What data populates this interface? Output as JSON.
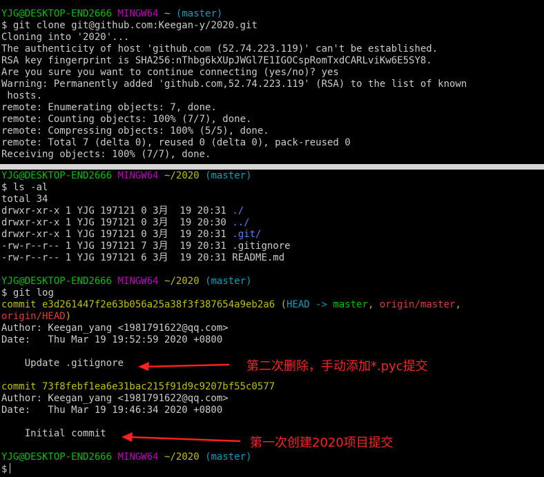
{
  "colors": {
    "prompt_user": "#00c000",
    "prompt_sys": "#c000c0",
    "path": "#c0c000",
    "branch": "#00a0c0",
    "commit": "#c0c000",
    "dir": "#5c7cff",
    "annotation": "#ff2020"
  },
  "prompt": {
    "user": "YJG@DESKTOP-END2666",
    "sys": "MINGW64",
    "home": "~",
    "repo": "~/2020",
    "branch": "(master)",
    "dollar": "$"
  },
  "p1": {
    "cmd": "git clone git@github.com:Keegan-y/2020.git",
    "out": [
      "Cloning into '2020'...",
      "The authenticity of host 'github.com (52.74.223.119)' can't be established.",
      "RSA key fingerprint is SHA256:nThbg6kXUpJWGl7E1IGOCspRomTxdCARLviKw6E5SY8.",
      "Are you sure you want to continue connecting (yes/no)? yes",
      "Warning: Permanently added 'github.com,52.74.223.119' (RSA) to the list of known",
      " hosts.",
      "remote: Enumerating objects: 7, done.",
      "remote: Counting objects: 100% (7/7), done.",
      "remote: Compressing objects: 100% (5/5), done.",
      "remote: Total 7 (delta 0), reused 0 (delta 0), pack-reused 0",
      "Receiving objects: 100% (7/7), done."
    ]
  },
  "p2": {
    "ls_cmd": "ls -al",
    "total": "total 34",
    "ls_rows": [
      {
        "meta": "drwxr-xr-x 1 YJG 197121 0 3月  19 20:31 ",
        "name": "./"
      },
      {
        "meta": "drwxr-xr-x 1 YJG 197121 0 3月  19 20:30 ",
        "name": "../"
      },
      {
        "meta": "drwxr-xr-x 1 YJG 197121 0 3月  19 20:31 ",
        "name": ".git/"
      },
      {
        "meta": "-rw-r--r-- 1 YJG 197121 7 3月  19 20:31 ",
        "name": ".gitignore"
      },
      {
        "meta": "-rw-r--r-- 1 YJG 197121 6 3月  19 20:31 ",
        "name": "README.md"
      }
    ],
    "log_cmd": "git log",
    "commit1": {
      "label": "commit e3d261447f2e63b056a25a38f3f387654a9eb2a6",
      "open": " (",
      "head": "HEAD -> ",
      "master": "master",
      "sep": ", ",
      "origin_master": "origin/master",
      "comma": ",",
      "origin_head": "origin/HEAD",
      "close": ")",
      "author": "Author: Keegan_yang <1981791622@qq.com>",
      "date": "Date:   Thu Mar 19 19:52:59 2020 +0800",
      "message": "    Update .gitignore"
    },
    "commit2": {
      "label": "commit 73f8febf1ea6e31bac215f91d9c9207bf55c0577",
      "author": "Author: Keegan_yang <1981791622@qq.com>",
      "date": "Date:   Thu Mar 19 19:46:34 2020 +0800",
      "message": "    Initial commit"
    }
  },
  "annotations": {
    "a1": "第二次删除，手动添加*.pyc提交",
    "a2": "第一次创建2020项目提交"
  }
}
